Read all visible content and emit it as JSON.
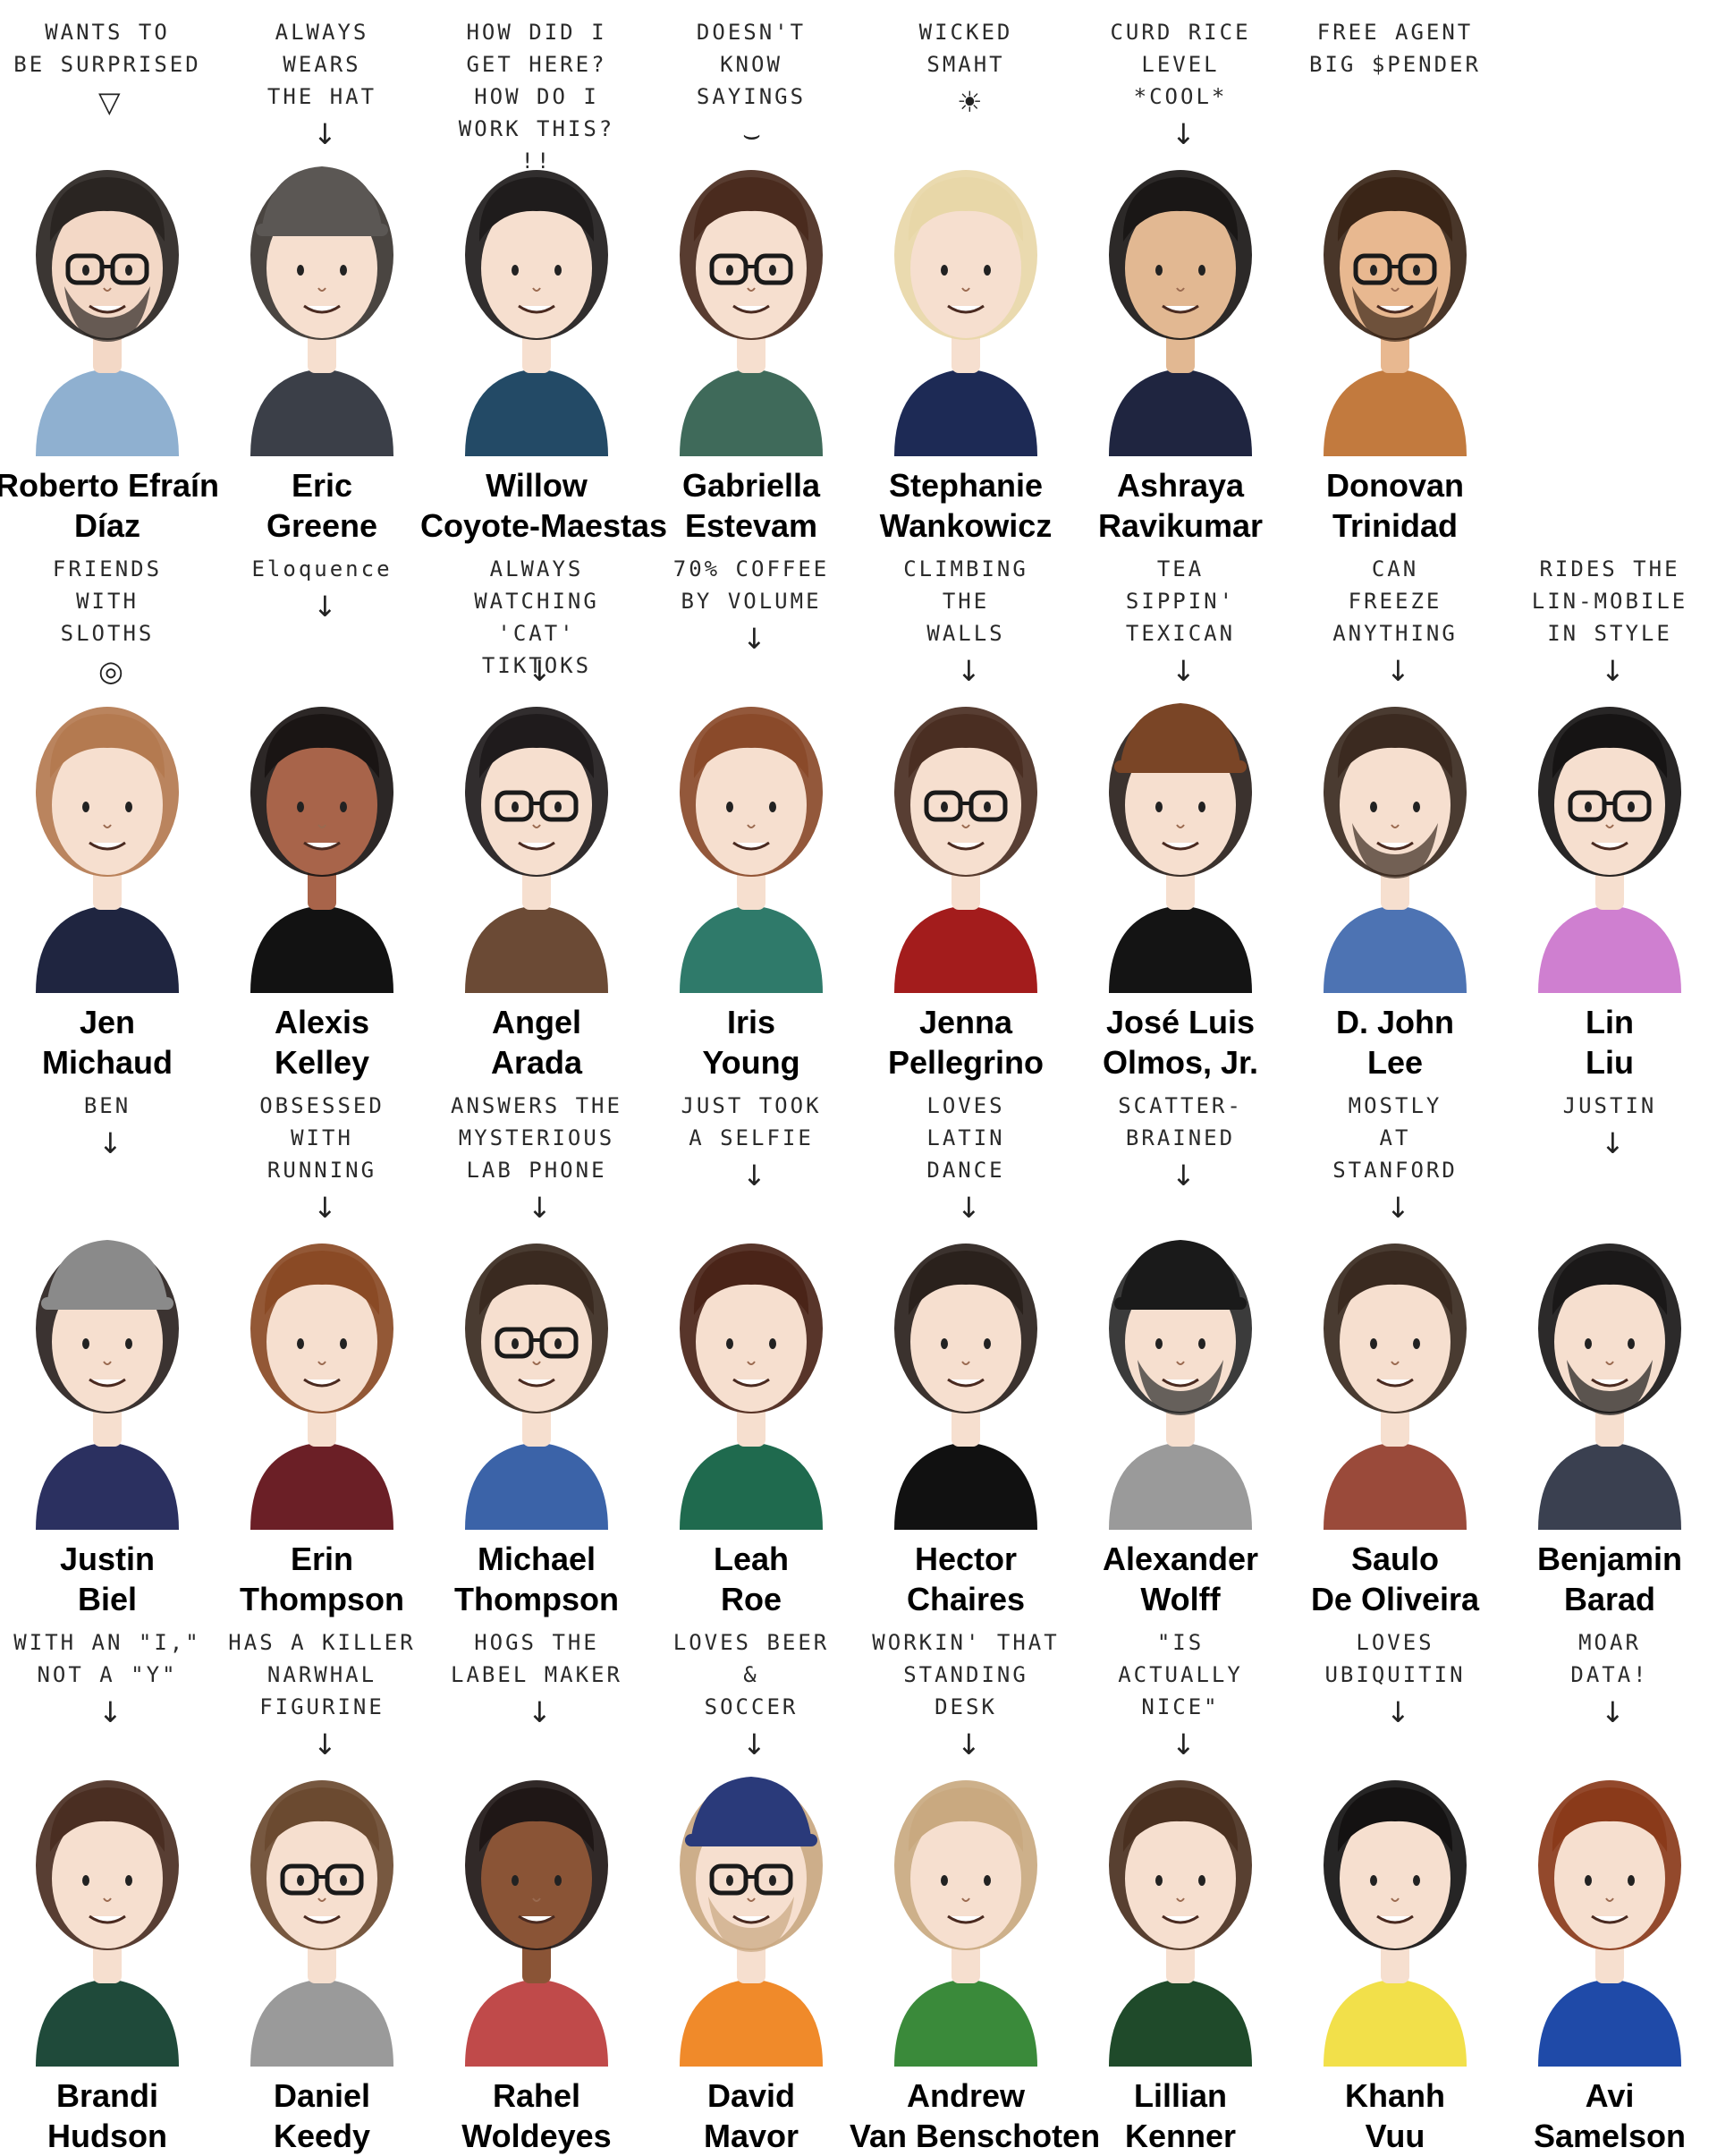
{
  "colors": {
    "background": "#ffffff",
    "text": "#000000",
    "skin_light": "#f6ddc9",
    "skin_medium": "#e6b48e",
    "skin_dark": "#8a5436",
    "hair_dark": "#262220",
    "hair_brown": "#6b3f24"
  },
  "people": [
    {
      "note": "WANTS TO\nBE SURPRISED",
      "first": "Roberto Efraín",
      "last": "Díaz",
      "icon": "ice-cream-icon",
      "hair": "#2a2522",
      "skin": "#f3d8c6",
      "shirt": "#8fb0d0",
      "glasses": true,
      "beard": true,
      "hat": ""
    },
    {
      "note": "ALWAYS\nWEARS\nTHE HAT",
      "first": "Eric",
      "last": "Greene",
      "icon": "arrow-icon",
      "hair": "#3b3531",
      "skin": "#f6dfcf",
      "shirt": "#3b3f48",
      "glasses": false,
      "beard": false,
      "hat": "#5b5754"
    },
    {
      "note": "HOW DID I GET HERE?\nHOW DO I WORK THIS?\n!!",
      "first": "Willow",
      "last": "Coyote-Maestas",
      "icon": "",
      "hair": "#1f1c1c",
      "skin": "#f6dfcf",
      "shirt": "#234a66",
      "glasses": false,
      "beard": false,
      "hat": ""
    },
    {
      "note": "DOESN'T\nKNOW\nSAYINGS",
      "first": "Gabriella",
      "last": "Estevam",
      "icon": "speech-bubble-icon",
      "hair": "#4a2b1e",
      "skin": "#f6dfcf",
      "shirt": "#3f6a5a",
      "glasses": true,
      "beard": false,
      "hat": ""
    },
    {
      "note": "WICKED\nSMAHT",
      "first": "Stephanie",
      "last": "Wankowicz",
      "icon": "lightbulb-icon",
      "hair": "#e8d7a8",
      "skin": "#f6dfcf",
      "shirt": "#1d2a55",
      "glasses": false,
      "beard": false,
      "hat": ""
    },
    {
      "note": "CURD RICE\nLEVEL\n*COOL*",
      "first": "Ashraya",
      "last": "Ravikumar",
      "icon": "arrow-icon",
      "hair": "#1a1716",
      "skin": "#e2b892",
      "shirt": "#1f2540",
      "glasses": false,
      "beard": false,
      "hat": ""
    },
    {
      "note": "FREE AGENT\nBIG $PENDER",
      "first": "Donovan",
      "last": "Trinidad",
      "icon": "",
      "hair": "#3a2517",
      "skin": "#e8b890",
      "shirt": "#c27a3e",
      "glasses": true,
      "beard": true,
      "hat": ""
    },
    {
      "note": "",
      "first": "",
      "last": "",
      "icon": "",
      "hair": "",
      "skin": "",
      "shirt": "",
      "glasses": false,
      "beard": false,
      "hat": ""
    },
    {
      "note": "FRIENDS\nWITH\nSLOTHS",
      "first": "Jen",
      "last": "Michaud",
      "icon": "sloth-icon",
      "hair": "#b47a50",
      "skin": "#f6dfcf",
      "shirt": "#1f2540",
      "glasses": false,
      "beard": false,
      "hat": ""
    },
    {
      "note": "Eloquence",
      "first": "Alexis",
      "last": "Kelley",
      "icon": "arrow-icon",
      "hair": "#1a1514",
      "skin": "#a8644a",
      "shirt": "#121212",
      "glasses": false,
      "beard": false,
      "hat": ""
    },
    {
      "note": "ALWAYS\nWATCHING\n'CAT' TIKTOKS",
      "first": "Angel",
      "last": "Arada",
      "icon": "arrow-icon",
      "hair": "#1f1b1c",
      "skin": "#f6dfcf",
      "shirt": "#6b4a35",
      "glasses": true,
      "beard": false,
      "hat": ""
    },
    {
      "note": "70% COFFEE\nBY VOLUME",
      "first": "Iris",
      "last": "Young",
      "icon": "coffee-icon",
      "hair": "#8a4a2a",
      "skin": "#f6dfcf",
      "shirt": "#2f7a6a",
      "glasses": false,
      "beard": false,
      "hat": ""
    },
    {
      "note": "CLIMBING\nTHE\nWALLS",
      "first": "Jenna",
      "last": "Pellegrino",
      "icon": "arrow-icon",
      "hair": "#4a2e22",
      "skin": "#f6dfcf",
      "shirt": "#a31c1c",
      "glasses": true,
      "beard": false,
      "hat": ""
    },
    {
      "note": "TEA\nSIPPIN'\nTEXICAN",
      "first": "José Luis",
      "last": "Olmos, Jr.",
      "icon": "arrow-icon",
      "hair": "#2a211c",
      "skin": "#f6dfcf",
      "shirt": "#141414",
      "glasses": false,
      "beard": false,
      "hat": "#7a4526"
    },
    {
      "note": "CAN\nFREEZE\nANYTHING",
      "first": "D. John",
      "last": "Lee",
      "icon": "arrow-icon",
      "hair": "#3b2a20",
      "skin": "#f6dfcf",
      "shirt": "#4d73b3",
      "glasses": false,
      "beard": true,
      "hat": ""
    },
    {
      "note": "RIDES THE\nLIN-MOBILE\nIN STYLE",
      "first": "Lin",
      "last": "Liu",
      "icon": "arrow-icon",
      "hair": "#161414",
      "skin": "#f6dfcf",
      "shirt": "#cf7fd0",
      "glasses": true,
      "beard": false,
      "hat": ""
    },
    {
      "note": "BEN",
      "first": "Justin",
      "last": "Biel",
      "icon": "arrow-icon",
      "hair": "#2a2220",
      "skin": "#f6dfcf",
      "shirt": "#2b3060",
      "glasses": false,
      "beard": false,
      "hat": "#8a8a8a"
    },
    {
      "note": "OBSESSED\nWITH\nRUNNING",
      "first": "Erin",
      "last": "Thompson",
      "icon": "arrow-icon",
      "hair": "#8a4a25",
      "skin": "#f6dfcf",
      "shirt": "#6b1f26",
      "glasses": false,
      "beard": false,
      "hat": ""
    },
    {
      "note": "ANSWERS THE\nMYSTERIOUS\nLAB PHONE",
      "first": "Michael",
      "last": "Thompson",
      "icon": "arrow-icon",
      "hair": "#3a2a20",
      "skin": "#f6dfcf",
      "shirt": "#3b63a8",
      "glasses": true,
      "beard": false,
      "hat": ""
    },
    {
      "note": "JUST TOOK\nA SELFIE",
      "first": "Leah",
      "last": "Roe",
      "icon": "arrow-icon",
      "hair": "#4a2418",
      "skin": "#f6dfcf",
      "shirt": "#1f6a4e",
      "glasses": false,
      "beard": false,
      "hat": ""
    },
    {
      "note": "LOVES\nLATIN\nDANCE",
      "first": "Hector",
      "last": "Chaires",
      "icon": "arrow-icon",
      "hair": "#2a211c",
      "skin": "#f6dfcf",
      "shirt": "#111111",
      "glasses": false,
      "beard": false,
      "hat": ""
    },
    {
      "note": "SCATTER-\nBRAINED",
      "first": "Alexander",
      "last": "Wolff",
      "icon": "arrow-icon",
      "hair": "#2a2a2a",
      "skin": "#f6dfcf",
      "shirt": "#9a9a9a",
      "glasses": false,
      "beard": true,
      "hat": "#1a1a1a"
    },
    {
      "note": "MOSTLY\nAT\nSTANFORD",
      "first": "Saulo",
      "last": "De Oliveira",
      "icon": "arrow-icon",
      "hair": "#3a2a20",
      "skin": "#f6dfcf",
      "shirt": "#9a4a3a",
      "glasses": false,
      "beard": false,
      "hat": ""
    },
    {
      "note": "JUSTIN",
      "first": "Benjamin",
      "last": "Barad",
      "icon": "arrow-icon",
      "hair": "#1a1818",
      "skin": "#f6dfcf",
      "shirt": "#3a4050",
      "glasses": false,
      "beard": true,
      "hat": ""
    },
    {
      "note": "WITH AN \"I,\"\nNOT A \"Y\"",
      "first": "Brandi",
      "last": "Hudson",
      "icon": "arrow-icon",
      "hair": "#4a2e22",
      "skin": "#f6dfcf",
      "shirt": "#1f4a3a",
      "glasses": false,
      "beard": false,
      "hat": ""
    },
    {
      "note": "HAS A KILLER\nNARWHAL\nFIGURINE",
      "first": "Daniel",
      "last": "Keedy",
      "icon": "arrow-icon",
      "hair": "#6b4a30",
      "skin": "#f6dfcf",
      "shirt": "#9a9a9a",
      "glasses": true,
      "beard": false,
      "hat": ""
    },
    {
      "note": "HOGS THE\nLABEL MAKER",
      "first": "Rahel",
      "last": "Woldeyes",
      "icon": "arrow-icon",
      "hair": "#1f1716",
      "skin": "#8a5436",
      "shirt": "#c04a4a",
      "glasses": false,
      "beard": false,
      "hat": ""
    },
    {
      "note": "LOVES BEER\n&\nSOCCER",
      "first": "David",
      "last": "Mavor",
      "icon": "arrow-icon",
      "hair": "#c9a780",
      "skin": "#f6dfcf",
      "shirt": "#f08a2a",
      "glasses": true,
      "beard": true,
      "hat": "#2a3a7a"
    },
    {
      "note": "WORKIN' THAT\nSTANDING\nDESK",
      "first": "Andrew",
      "last": "Van Benschoten",
      "icon": "arrow-icon",
      "hair": "#c9a980",
      "skin": "#f6dfcf",
      "shirt": "#3a8a3a",
      "glasses": false,
      "beard": false,
      "hat": ""
    },
    {
      "note": "\"IS\nACTUALLY\nNICE\"",
      "first": "Lillian",
      "last": "Kenner",
      "icon": "arrow-icon",
      "hair": "#4a3020",
      "skin": "#f6dfcf",
      "shirt": "#1f4a2a",
      "glasses": false,
      "beard": false,
      "hat": ""
    },
    {
      "note": "LOVES\nUBIQUITIN",
      "first": "Khanh",
      "last": "Vuu",
      "icon": "arrow-icon",
      "hair": "#141212",
      "skin": "#f6dfcf",
      "shirt": "#f2e04a",
      "glasses": false,
      "beard": false,
      "hat": ""
    },
    {
      "note": "MOAR\nDATA!",
      "first": "Avi",
      "last": "Samelson",
      "icon": "arrow-icon",
      "hair": "#8a3a1a",
      "skin": "#f6dfcf",
      "shirt": "#1f4aa8",
      "glasses": false,
      "beard": false,
      "hat": ""
    }
  ]
}
